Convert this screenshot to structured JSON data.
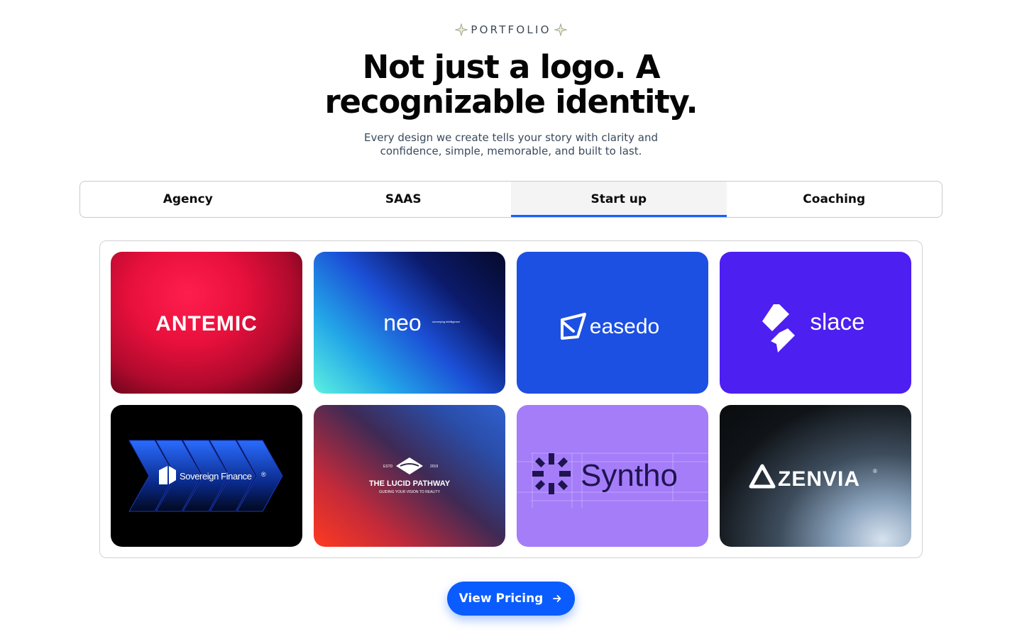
{
  "header": {
    "eyebrow": "PORTFOLIO",
    "title_line1": "Not just a logo. A",
    "title_line2": "recognizable identity.",
    "subtitle_line1": "Every design we create tells your story with clarity and",
    "subtitle_line2": "confidence, simple, memorable, and built to last."
  },
  "tabs": [
    {
      "label": "Agency",
      "active": false
    },
    {
      "label": "SAAS",
      "active": false
    },
    {
      "label": "Start up",
      "active": true
    },
    {
      "label": "Coaching",
      "active": false
    }
  ],
  "cards": [
    {
      "logo": "ANTEMIC",
      "icon": "none"
    },
    {
      "logo": "neo",
      "tagline": "conveying intelligence",
      "icon": "none"
    },
    {
      "logo": "easedo",
      "icon": "paper-plane-icon"
    },
    {
      "logo": "slace",
      "icon": "slace-mark-icon"
    },
    {
      "logo": "Sovereign Finance",
      "mark": "®",
      "icon": "chevron-arrows-icon"
    },
    {
      "logo": "THE LUCID PATHWAY",
      "tagline": "GUIDING YOUR VISION TO REALITY",
      "estd": "ESTD",
      "year": "2019",
      "icon": "eye-diamond-icon"
    },
    {
      "logo": "Syntho",
      "icon": "asterisk-grid-icon"
    },
    {
      "logo": "ZENVIA",
      "mark": "®",
      "icon": "triangle-mark-icon"
    }
  ],
  "cta": {
    "label": "View Pricing",
    "icon": "arrow-right-icon"
  },
  "colors": {
    "accent": "#0b5cff",
    "tab_underline": "#1560ff"
  }
}
